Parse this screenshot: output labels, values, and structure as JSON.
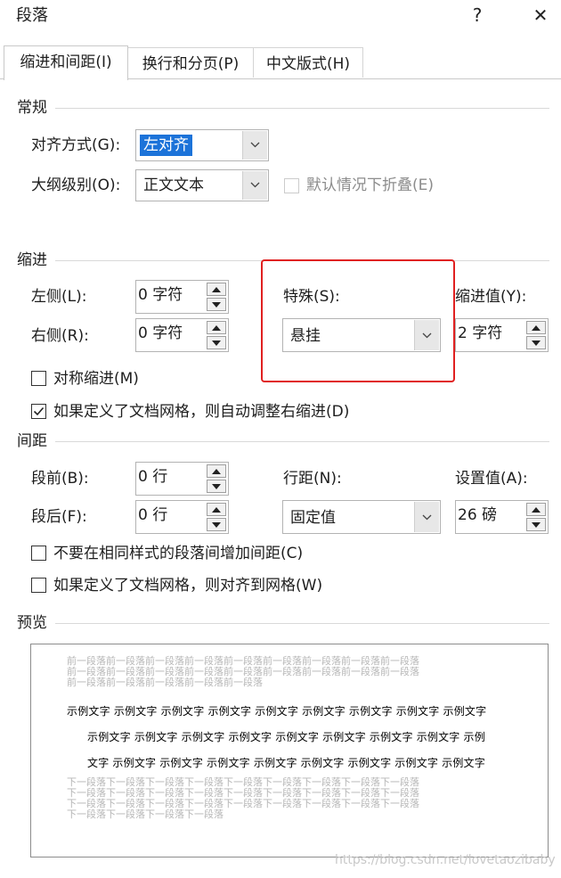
{
  "dialog": {
    "title": "段落",
    "help_glyph": "?",
    "close_glyph": "✕"
  },
  "tabs": [
    {
      "label": "缩进和间距(I)"
    },
    {
      "label": "换行和分页(P)"
    },
    {
      "label": "中文版式(H)"
    }
  ],
  "general": {
    "header": "常规",
    "alignment_label": "对齐方式(G):",
    "alignment_value": "左对齐",
    "outline_label": "大纲级别(O):",
    "outline_value": "正文文本",
    "collapse_label": "默认情况下折叠(E)"
  },
  "indent": {
    "header": "缩进",
    "left_label": "左侧(L):",
    "left_value": "0 字符",
    "right_label": "右侧(R):",
    "right_value": "0 字符",
    "special_label": "特殊(S):",
    "special_value": "悬挂",
    "by_label": "缩进值(Y):",
    "by_value": "2 字符",
    "mirror_label": "对称缩进(M)",
    "auto_adjust_label": "如果定义了文档网格，则自动调整右缩进(D)"
  },
  "spacing": {
    "header": "间距",
    "before_label": "段前(B):",
    "before_value": "0 行",
    "after_label": "段后(F):",
    "after_value": "0 行",
    "line_spacing_label": "行距(N):",
    "line_spacing_value": "固定值",
    "at_label": "设置值(A):",
    "at_value": "26 磅",
    "dont_add_label": "不要在相同样式的段落间增加间距(C)",
    "snap_grid_label": "如果定义了文档网格，则对齐到网格(W)"
  },
  "preview": {
    "header": "预览",
    "prev_lines": [
      "前一段落前一段落前一段落前一段落前一段落前一段落前一段落前一段落前一段落",
      "前一段落前一段落前一段落前一段落前一段落前一段落前一段落前一段落前一段落",
      "前一段落前一段落前一段落前一段落前一段落"
    ],
    "sample_lines": [
      "示例文字 示例文字 示例文字 示例文字 示例文字 示例文字 示例文字 示例文字 示例文字",
      "示例文字 示例文字 示例文字 示例文字 示例文字 示例文字 示例文字 示例文字 示例",
      "文字 示例文字 示例文字 示例文字 示例文字 示例文字 示例文字 示例文字 示例文字"
    ],
    "next_lines": [
      "下一段落下一段落下一段落下一段落下一段落下一段落下一段落下一段落下一段落",
      "下一段落下一段落下一段落下一段落下一段落下一段落下一段落下一段落下一段落",
      "下一段落下一段落下一段落下一段落下一段落下一段落下一段落下一段落下一段落",
      "下一段落下一段落下一段落下一段落"
    ]
  },
  "watermark": "https://blog.csdn.net/lovetaozibaby",
  "colors": {
    "highlight": "#1c73d9",
    "annotation_box": "#e02020"
  }
}
